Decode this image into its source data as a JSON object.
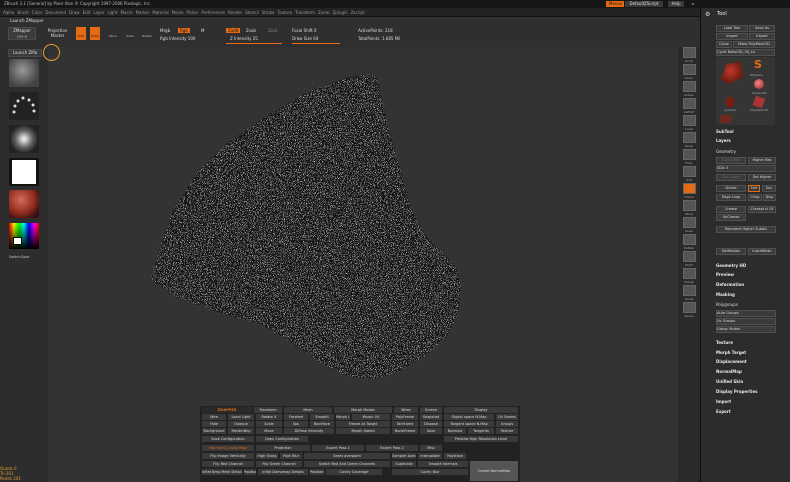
{
  "window": {
    "title": "ZBrush 3.1 [General] by Pixer Xlon © Copyright 1997-2006 Pixologic, Inc.",
    "menus_btn": "Menus",
    "default_script": "DefaultZScript",
    "help": "Help"
  },
  "menu": [
    "Alpha",
    "Brush",
    "Color",
    "Document",
    "Draw",
    "Edit",
    "Layer",
    "Light",
    "Macro",
    "Marker",
    "Material",
    "Movie",
    "Picker",
    "Preferences",
    "Render",
    "Stencil",
    "Stroke",
    "Texture",
    "Transform",
    "Zoom",
    "Zplugin",
    "Zscript"
  ],
  "toolbar": {
    "launch": "Launch ZMapper",
    "zmapper_btn": "ZMapper",
    "zmapper_sub": "rev-e",
    "projection": "Projection",
    "master": "Master",
    "edit": "Edit",
    "draw": "Draw",
    "move": "Move",
    "scale": "Scale",
    "rotate": "Rotate",
    "mrgb": "Mrgb",
    "rgb": "Rgb",
    "m": "M",
    "rgb_intensity": "Rgb Intensity 100",
    "zadd": "Zadd",
    "zsub": "Zsub",
    "zcut": "Zcut",
    "z_intensity": "Z Intensity 25",
    "focal_shift": "Focal Shift 0",
    "draw_size": "Draw Size 64",
    "active_points": "ActivePoints: 218",
    "total_points": "TotalPoints: 1.685 Mil"
  },
  "left": {
    "launch_btn": "Launch ZMa",
    "switch_color": "SwitchColor"
  },
  "right": [
    "Scroll",
    "Zoom",
    "Actual",
    "AAHalf",
    "Local",
    "Persp",
    "Floor",
    "XYZ",
    "Frame",
    "Move",
    "Scale",
    "Rotate",
    "PolyF",
    "Transp",
    "Ghost",
    "Xpose"
  ],
  "tool": {
    "header": "Tool",
    "load": "Load Tool",
    "save_as": "Save As",
    "import": "Import",
    "export": "Export",
    "clone": "Clone",
    "make_poly": "Make PolyMesh3D",
    "cycle": "Cycle Ballot3D_36_44",
    "thumbs": [
      "ZSphere",
      "Sphere3D",
      "Cylinder",
      "PolyMesh3D"
    ],
    "subtool": "SubTool",
    "layers": "Layers",
    "geometry": "Geometry",
    "lower_res": "Lower Res",
    "higher_res": "Higher Res",
    "sdiv": "SDiv 3",
    "del_lower": "Del Lower",
    "del_higher": "Del Higher",
    "divide": "Divide",
    "smt": "Smt",
    "suv": "Suv",
    "edge_loop": "Edge Loop",
    "crisp": "Crisp",
    "disp": "Disp",
    "crease": "Crease",
    "crease_lvl": "CreaseLvl 15",
    "uncrease": "UnCrease",
    "reproject": "Reproject Higher Subdiv",
    "del_hidden": "DelHidden",
    "insert_mesh": "InsertMesh",
    "sections": [
      "Geometry HD",
      "Preview",
      "Deformation",
      "Masking"
    ],
    "polygroups": "Polygroups",
    "auto_groups": "Auto Groups",
    "uv_groups": "Uv Groups",
    "group_visible": "Group Visible",
    "sections2": [
      "Texture",
      "Morph Target",
      "Displacement",
      "NormalMap",
      "Unified Skin",
      "Display Properties",
      "Import",
      "Export"
    ]
  },
  "mapper": {
    "title": "ZMAPPER",
    "tabs": [
      "Transform",
      "Mesh",
      "Morph Modes",
      "Wires",
      "Screen",
      "Display"
    ],
    "row1": [
      "Wire",
      "Local Light",
      "Rotate X",
      "Faceted",
      "Smooth",
      "Morph UV",
      "Morph UV",
      "PolyFrame",
      "Snapshot",
      "Object space N.Map",
      "UV Seams"
    ],
    "row2": [
      "Hide",
      "Opaque",
      "Scale",
      "Sps",
      "Backface",
      "Freeze At Target",
      "TanFrame",
      "Dispose",
      "Tangent space N.Map",
      "Groups"
    ],
    "row3": [
      "Background",
      "RenderBkp",
      "Move",
      "Diffuse Intensity",
      "Morph Speed",
      "NormFrame",
      "Save",
      "Normals",
      "Tangents",
      "Texture"
    ],
    "row4": [
      "Save Configuration",
      "Open Configuration",
      "Preview High Resolution Level"
    ],
    "row5": [
      "Normal & Cavity Map",
      "Projection",
      "Expert Pass 1",
      "Expert Pass 2",
      "Misc"
    ],
    "row6": [
      "Flip Image Vertically",
      "High Sharp",
      "High Blur",
      "Seam overpaint",
      "Sampler Average",
      "Interpolate",
      "Raytrace"
    ],
    "row7": [
      "Flip Red Channel",
      "Flip Green Channel",
      "Switch Red And Green Channels",
      "Subdivide",
      "Smooth Normals",
      "Create NormalMap"
    ],
    "row8": [
      "Inflat Bmp Mesh Details",
      "Positions",
      "Inflat Dampmap Details",
      "Positions",
      "Cavity Coverage",
      "Cavity Blur"
    ]
  },
  "status": [
    "Quads 0",
    "Tri 201",
    "Points 201"
  ],
  "colors": {
    "accent": "#e46b13",
    "bg": "#2b2b2b",
    "panel": "#2c2c2c"
  }
}
